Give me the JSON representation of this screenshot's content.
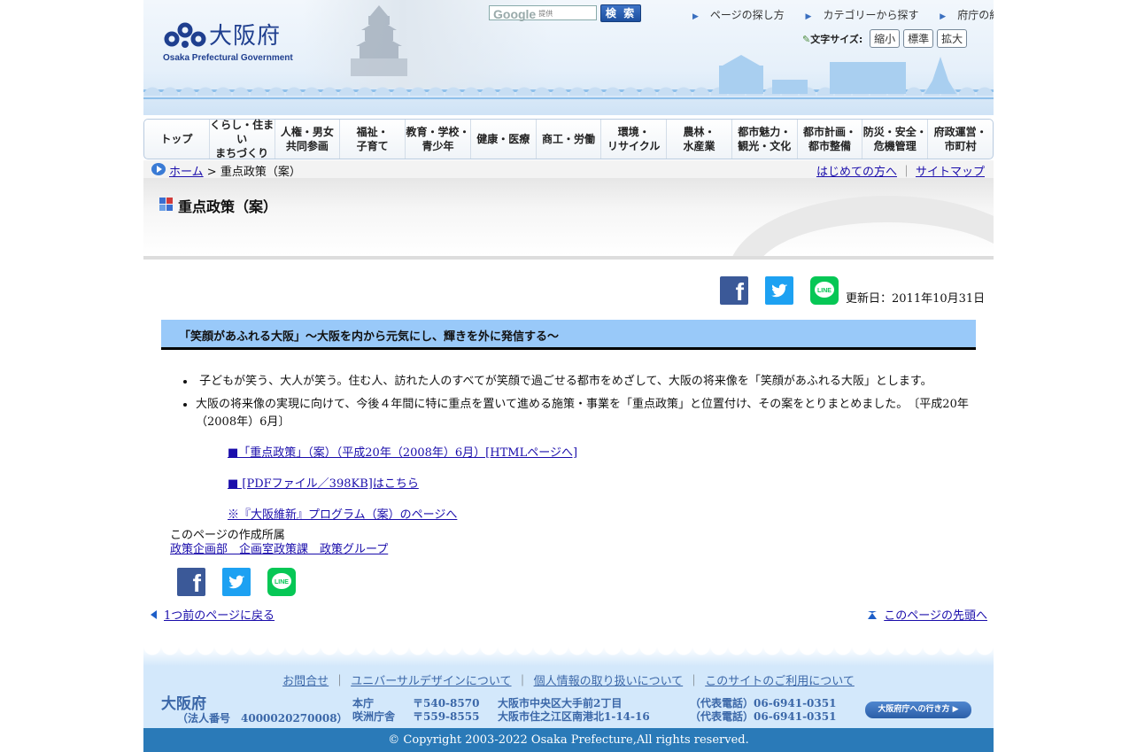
{
  "header": {
    "logo_text": "大阪府",
    "logo_sub": "Osaka Prefectural Government",
    "search": {
      "placeholder_brand": "Google",
      "placeholder_small": "提供",
      "button": "検 索"
    },
    "top_links": [
      "ページの探し方",
      "カテゴリーから探す",
      "府庁の組織から探す"
    ],
    "font_size": {
      "label": "文字サイズ:",
      "buttons": [
        "縮小",
        "標準",
        "拡大"
      ]
    }
  },
  "nav": [
    "トップ",
    "くらし・住まい\nまちづくり",
    "人権・男女\n共同参画",
    "福祉・\n子育て",
    "教育・学校・\n青少年",
    "健康・医療",
    "商工・労働",
    "環境・\nリサイクル",
    "農林・\n水産業",
    "都市魅力・\n観光・文化",
    "都市計画・\n都市整備",
    "防災・安全・\n危機管理",
    "府政運営・\n市町村"
  ],
  "breadcrumb": {
    "home": "ホーム",
    "sep": ">",
    "current": "重点政策（案）",
    "first_time": "はじめての方へ",
    "sitemap": "サイトマップ",
    "bar": "｜"
  },
  "page": {
    "title": "重点政策（案）",
    "updated": "更新日：2011年10月31日",
    "heading": "「笑顔があふれる大阪」～大阪を内から元気にし、輝きを外に発信する～",
    "bullets": [
      "子どもが笑う、大人が笑う。住む人、訪れた人のすべてが笑顔で過ごせる都市をめざして、大阪の将来像を「笑顔があふれる大阪」とします。",
      "大阪の将来像の実現に向けて、今後４年間に特に重点を置いて進める施策・事業を「重点政策」と位置付け、その案をとりまとめました。　〔平成20年（2008年）6月〕"
    ],
    "links": [
      "■「重点政策」（案）（平成20年（2008年）6月）[HTMLページへ]",
      "■ [PDFファイル／398KB]はこちら",
      "※『大阪維新』プログラム（案）のページへ"
    ],
    "owner_label": "このページの作成所属",
    "owner": "政策企画部　企画室政策課　政策グループ",
    "back": "1つ前のページに戻る",
    "to_top": "このページの先頭へ"
  },
  "footer": {
    "links": [
      "お問合せ",
      "ユニバーサルデザインについて",
      "個人情報の取り扱いについて",
      "このサイトのご利用について"
    ],
    "bar": "｜",
    "pref": "大阪府",
    "corp_no": "（法人番号　4000020270008）",
    "offices": [
      {
        "name": "本庁",
        "zip": "〒540-8570",
        "address": "大阪市中央区大手前2丁目",
        "tel": "（代表電話）06-6941-0351"
      },
      {
        "name": "咲洲庁舎",
        "zip": "〒559-8555",
        "address": "大阪市住之江区南港北1-14-16",
        "tel": "（代表電話）06-6941-0351"
      }
    ],
    "access_button": "大阪府庁への行き方",
    "copyright": "© Copyright 2003-2022 Osaka Prefecture,All rights reserved."
  },
  "colors": {
    "heading_bg": "#99c9f9",
    "footer_bg": "#d3e8fb",
    "copyright_bg": "#2a7ab8",
    "brand": "#1f3f8f"
  }
}
